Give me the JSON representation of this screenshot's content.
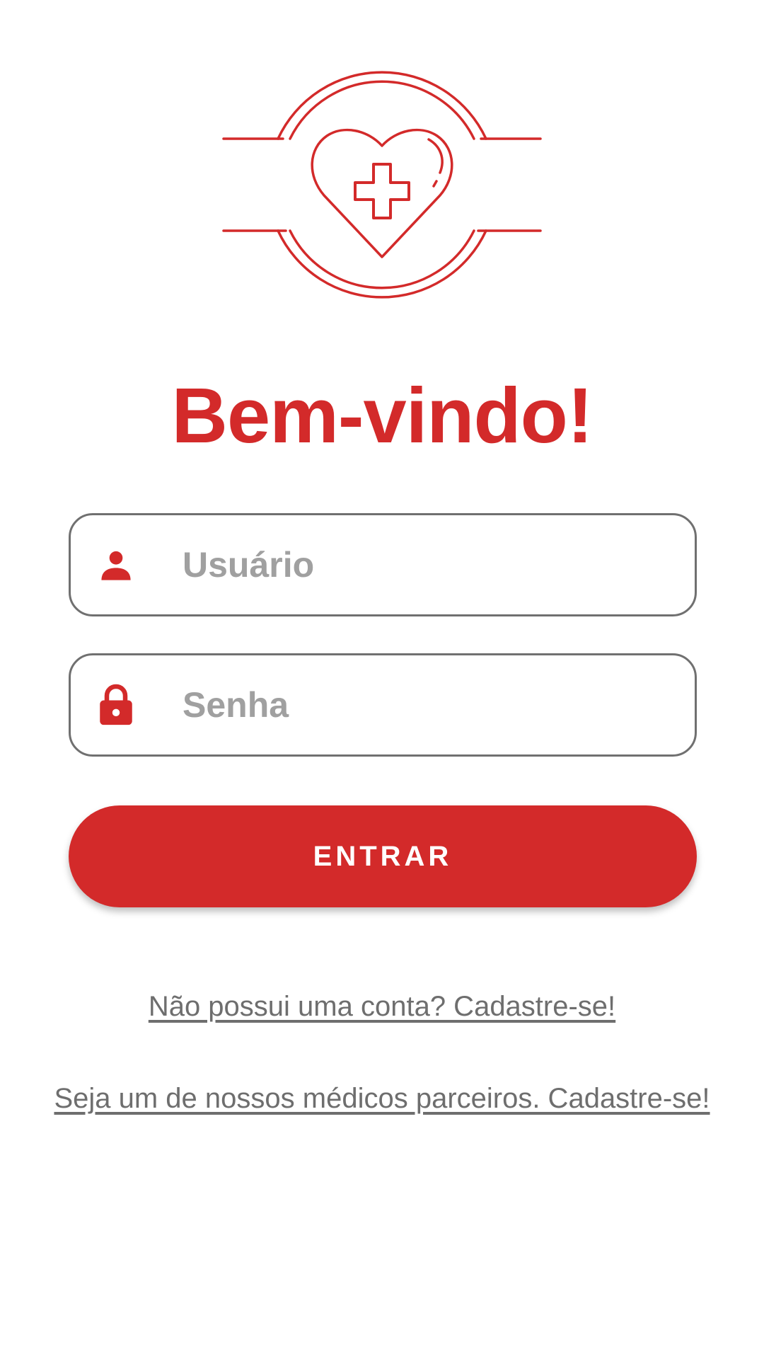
{
  "colors": {
    "brand": "#d32a2a",
    "border": "#707070",
    "placeholder": "#a0a0a0",
    "link": "#6e6e6e"
  },
  "logo": {
    "icon": "heart-cross-logo-icon"
  },
  "header": {
    "title": "Bem-vindo!"
  },
  "form": {
    "username": {
      "icon": "person-icon",
      "placeholder": "Usuário",
      "value": ""
    },
    "password": {
      "icon": "lock-icon",
      "placeholder": "Senha",
      "value": ""
    },
    "submit_label": "ENTRAR"
  },
  "links": {
    "signup": "Não possui uma conta? Cadastre-se!",
    "partner_signup": "Seja um de nossos médicos parceiros. Cadastre-se!"
  }
}
